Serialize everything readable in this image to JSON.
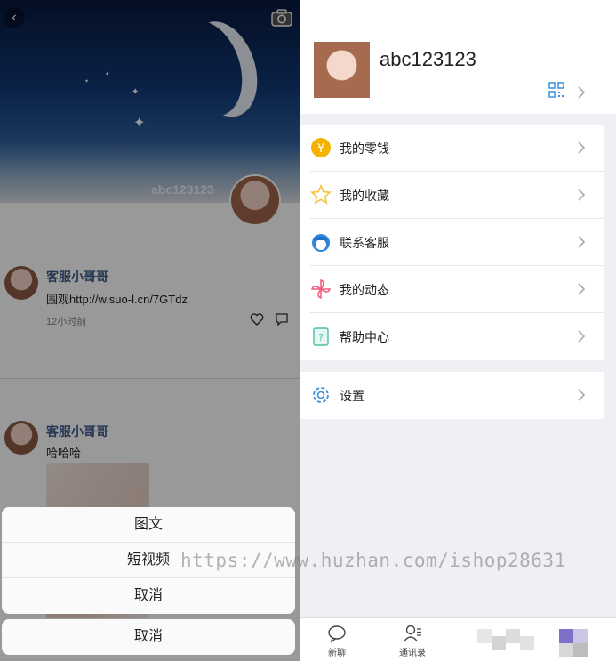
{
  "moments": {
    "cover_name": "abc123123",
    "posts": [
      {
        "author": "客服小哥哥",
        "text": "围观http://w.suo-l.cn/7GTdz",
        "time": "12小时前"
      },
      {
        "author": "客服小哥哥",
        "text": "哈哈哈"
      }
    ]
  },
  "action_sheet": {
    "options": [
      "图文",
      "短视频",
      "取消"
    ],
    "cancel": "取消"
  },
  "profile": {
    "username": "abc123123"
  },
  "menu_group_1": [
    {
      "label": "我的零钱",
      "icon": "wallet-yen-icon"
    },
    {
      "label": "我的收藏",
      "icon": "star-icon"
    },
    {
      "label": "联系客服",
      "icon": "customer-service-icon"
    },
    {
      "label": "我的动态",
      "icon": "pinwheel-icon"
    },
    {
      "label": "帮助中心",
      "icon": "help-center-icon"
    }
  ],
  "menu_group_2": [
    {
      "label": "设置",
      "icon": "gear-icon"
    }
  ],
  "tabbar": [
    {
      "label": "新聊",
      "icon": "chat-bubble-icon"
    },
    {
      "label": "通讯录",
      "icon": "contacts-icon"
    }
  ],
  "watermark": "https://www.huzhan.com/ishop28631",
  "colors": {
    "link_blue": "#3d5a8a",
    "accent_blue": "#3b8fe0",
    "wallet_yellow": "#f5b300",
    "star_yellow": "#f7c33c",
    "pinwheel_pink": "#ef5a7f"
  }
}
